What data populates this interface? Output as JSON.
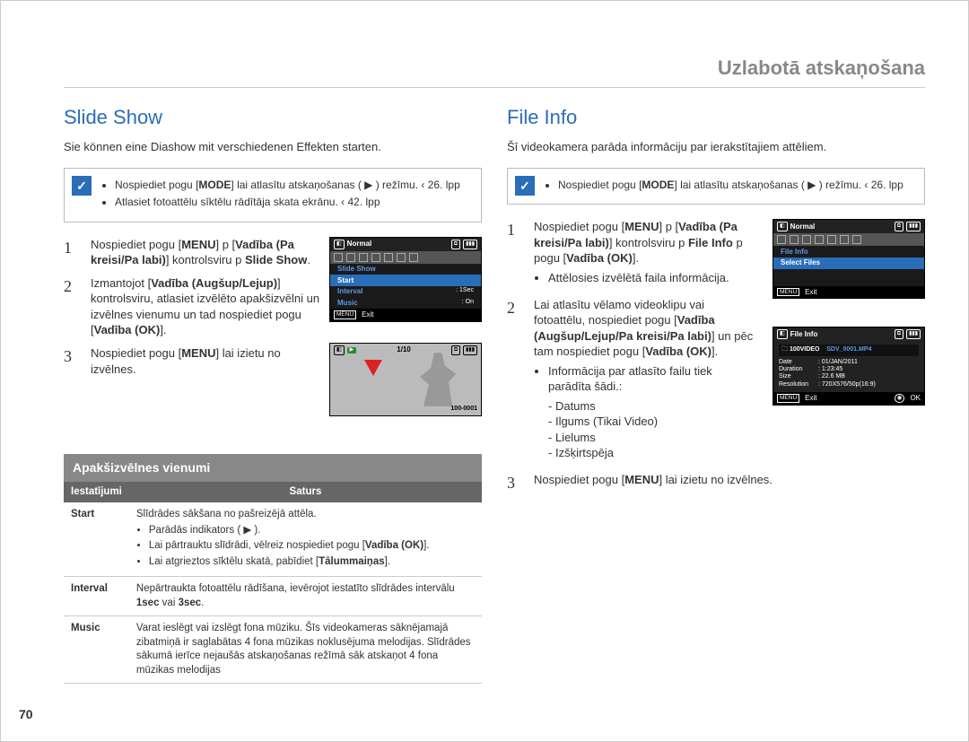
{
  "page": {
    "number": "70",
    "header": "Uzlabotā atskaņošana"
  },
  "left": {
    "title": "Slide Show",
    "intro": "Sie können eine Diashow mit verschiedenen Effekten starten.",
    "note": {
      "item1_a": "Nospiediet pogu [",
      "item1_b": "MODE",
      "item1_c": "] lai atlasītu atskaņošanas ( ▶ ) režīmu. ‹ 26. lpp",
      "item2": "Atlasiet fotoattēlu sīktēlu rādītāja skata ekrānu. ‹ 42. lpp"
    },
    "steps": {
      "s1_a": "Nospiediet pogu [",
      "s1_b": "MENU",
      "s1_c": "] p [",
      "s1_d": "Vadība (Pa kreisi/Pa labi)",
      "s1_e": "] kontrolsviru p ",
      "s1_f": "Slide Show",
      "s1_g": ".",
      "s2_a": "Izmantojot [",
      "s2_b": "Vadība (Augšup/Lejup)",
      "s2_c": "] kontrolsviru, atlasiet izvēlēto apakšizvēlni un izvēlnes vienumu un tad nospiediet pogu [",
      "s2_d": "Vadība (OK)",
      "s2_e": "].",
      "s3_a": "Nospiediet pogu [",
      "s3_b": "MENU",
      "s3_c": "] lai izietu no izvēlnes."
    },
    "lcd1": {
      "normal": "Normal",
      "title": "Slide Show",
      "start": "Start",
      "interval_l": "Interval",
      "interval_v": "1Sec",
      "music_l": "Music",
      "music_v": "On",
      "exit": "Exit",
      "menu": "MENU"
    },
    "lcd2": {
      "counter_top": "1/10",
      "counter_bottom": "100-0001",
      "green_badge": "▶"
    },
    "sub_heading": "Apakšizvēlnes vienumi",
    "table": {
      "h1": "Iestatījumi",
      "h2": "Saturs",
      "row1_k": "Start",
      "row1_v_line1": "Slīdrādes sākšana no pašreizējā attēla.",
      "row1_li1": "Parādās indikators ( ▶ ).",
      "row1_li2_a": "Lai pārtrauktu slīdrādi, vēlreiz nospiediet pogu [",
      "row1_li2_b": "Vadība (OK)",
      "row1_li2_c": "].",
      "row1_li3_a": "Lai atgrieztos sīktēlu skatā, pabīdiet [",
      "row1_li3_b": "Tālummaiņas",
      "row1_li3_c": "].",
      "row2_k": "Interval",
      "row2_v": "Nepārtraukta fotoattēlu rādīšana, ievērojot iestatīto slīdrādes intervālu 1sec vai 3sec.",
      "row2_b1": "1sec",
      "row2_b2": "3sec",
      "row3_k": "Music",
      "row3_v": "Varat ieslēgt vai izslēgt fona mūziku. Šīs videokameras sāknējamajā zibatmiņā ir saglabātas 4 fona mūzikas noklusējuma melodijas. Slīdrādes sākumā ierīce nejaušās atskaņošanas režīmā sāk atskaņot 4 fona mūzikas melodijas"
    }
  },
  "right": {
    "title": "File Info",
    "intro": "Šī videokamera parāda informāciju par ierakstītajiem attēliem.",
    "note": {
      "item1_a": "Nospiediet pogu [",
      "item1_b": "MODE",
      "item1_c": "] lai atlasītu atskaņošanas ( ▶ ) režīmu. ‹ 26. lpp"
    },
    "steps": {
      "s1_a": "Nospiediet pogu [",
      "s1_b": "MENU",
      "s1_c": "] p [",
      "s1_d": "Vadība (Pa kreisi/Pa labi)",
      "s1_e": "] kontrolsviru p ",
      "s1_f": "File Info",
      "s1_g": " p pogu [",
      "s1_h": "Vadība (OK)",
      "s1_i": "].",
      "s1_bullet": "Attēlosies izvēlētā faila informācija.",
      "s2_a": "Lai atlasītu vēlamo videoklipu vai fotoattēlu, nospiediet pogu [",
      "s2_b": "Vadība (Augšup/Lejup/Pa kreisi/Pa labi)",
      "s2_c": "] un pēc tam nospiediet pogu [",
      "s2_d": "Vadība (OK)",
      "s2_e": "].",
      "s2_bullet_intro": "Informācija par atlasīto failu tiek parādīta šādi.:",
      "s2_li1": "Datums",
      "s2_li2": "Ilgums (Tikai Video)",
      "s2_li3": "Lielums",
      "s2_li4": "Izšķirtspēja",
      "s3_a": "Nospiediet pogu [",
      "s3_b": "MENU",
      "s3_c": "] lai izietu no izvēlnes."
    },
    "lcd3": {
      "normal": "Normal",
      "fileinfo": "File Info",
      "select": "Select Files",
      "exit": "Exit",
      "menu": "MENU"
    },
    "lcd4": {
      "title": "File Info",
      "folder": "100VIDEO",
      "file": "SDV_0001.MP4",
      "date_l": "Date",
      "date_v": "01/JAN/2011",
      "dur_l": "Duration",
      "dur_v": "1:23:45",
      "size_l": "Size",
      "size_v": "22.6 MB",
      "res_l": "Resolution",
      "res_v": "720X576/50p(16:9)",
      "exit": "Exit",
      "ok": "OK",
      "menu": "MENU"
    }
  }
}
